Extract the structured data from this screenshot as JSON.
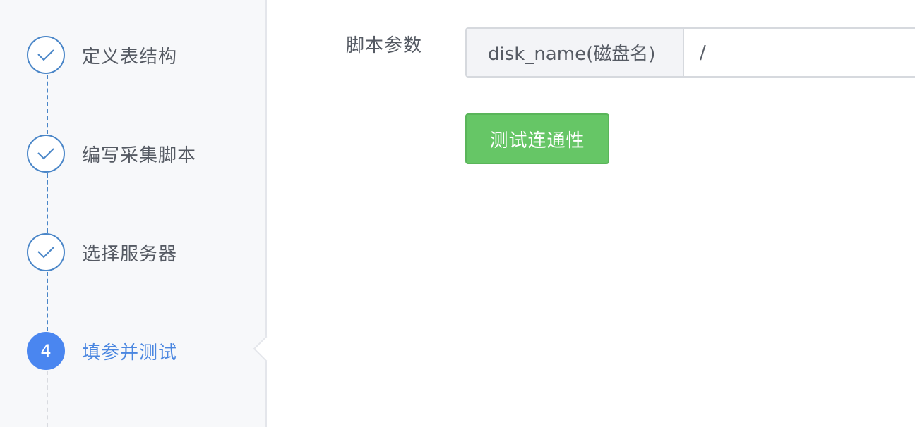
{
  "colors": {
    "accent": "#4a86f0",
    "done_line": "#4a86c8",
    "button_green": "#66c666"
  },
  "steps": [
    {
      "label": "定义表结构",
      "status": "done",
      "icon": "check-icon"
    },
    {
      "label": "编写采集脚本",
      "status": "done",
      "icon": "check-icon"
    },
    {
      "label": "选择服务器",
      "status": "done",
      "icon": "check-icon"
    },
    {
      "label": "填参并测试",
      "status": "active",
      "number": "4"
    }
  ],
  "form": {
    "script_params_label": "脚本参数",
    "param_name": "disk_name(磁盘名)",
    "param_value": "/",
    "test_button_label": "测试连通性"
  }
}
